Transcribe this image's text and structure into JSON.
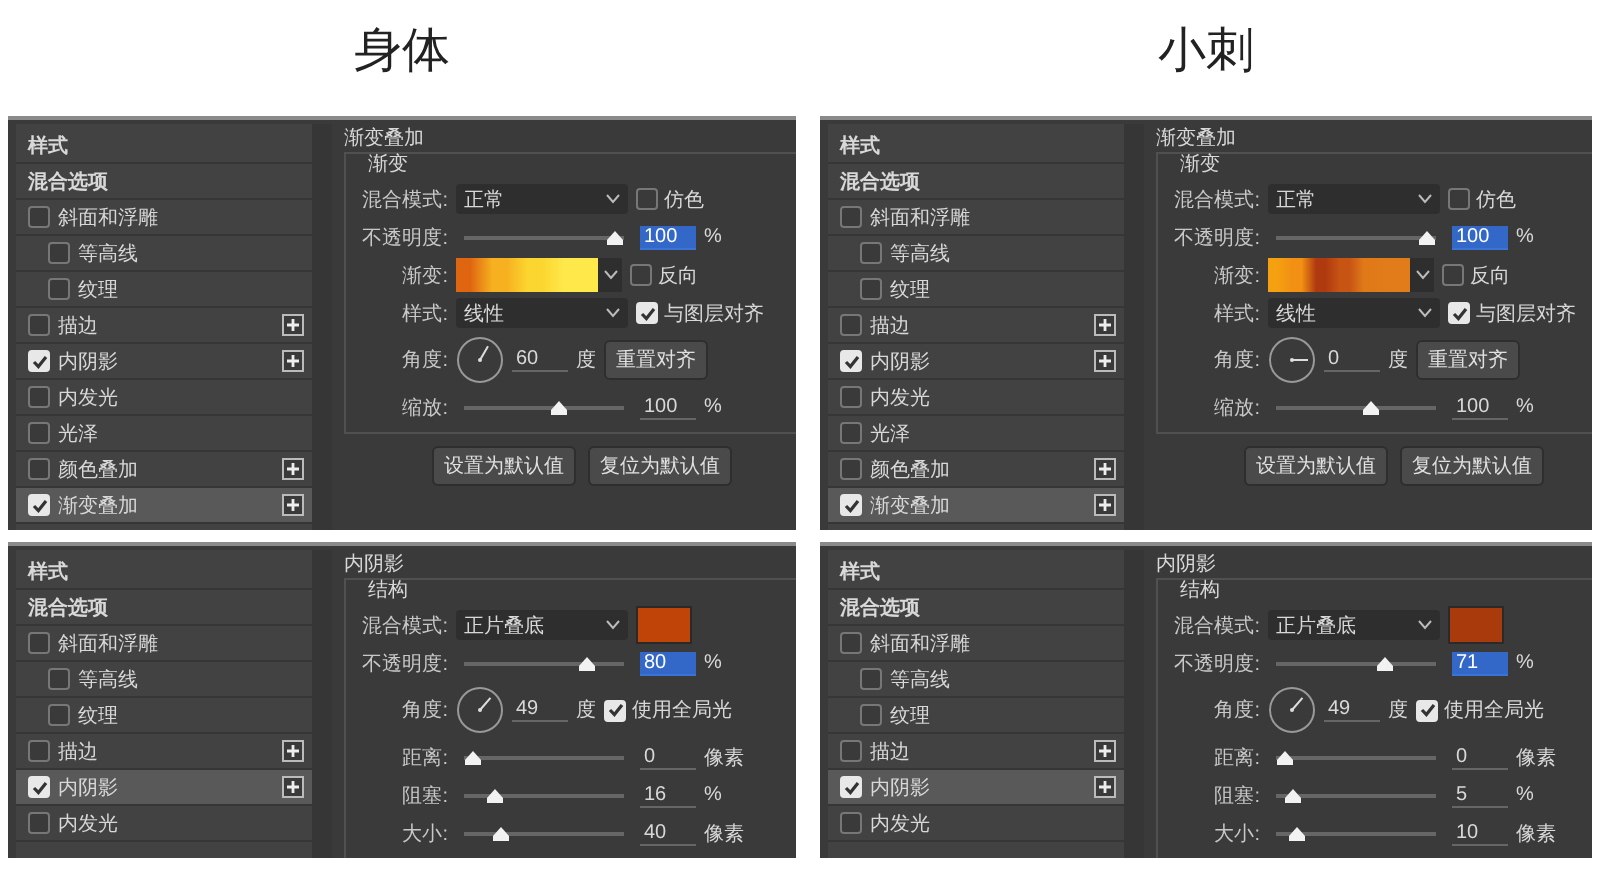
{
  "columns": [
    {
      "heading": "身体",
      "panels": [
        {
          "styles_list": [
            {
              "label": "样式",
              "kind": "header",
              "selected": false
            },
            {
              "label": "混合选项",
              "kind": "header",
              "selected": false
            },
            {
              "label": "斜面和浮雕",
              "kind": "check",
              "checked": false,
              "selected": false,
              "children": [
                {
                  "label": "等高线",
                  "kind": "check",
                  "checked": false,
                  "selected": false
                },
                {
                  "label": "纹理",
                  "kind": "check",
                  "checked": false,
                  "selected": false
                }
              ]
            },
            {
              "label": "描边",
              "kind": "check",
              "checked": false,
              "selected": false,
              "add": true
            },
            {
              "label": "内阴影",
              "kind": "check",
              "checked": true,
              "selected": false,
              "add": true
            },
            {
              "label": "内发光",
              "kind": "check",
              "checked": false,
              "selected": false
            },
            {
              "label": "光泽",
              "kind": "check",
              "checked": false,
              "selected": false
            },
            {
              "label": "颜色叠加",
              "kind": "check",
              "checked": false,
              "selected": false,
              "add": true
            },
            {
              "label": "渐变叠加",
              "kind": "check",
              "checked": true,
              "selected": true,
              "add": true
            }
          ],
          "section_title": "渐变叠加",
          "group_title": "渐变",
          "rows": [
            {
              "kind": "dropdown",
              "label": "混合模式:",
              "value": "正常",
              "checkbox": {
                "label": "仿色",
                "checked": false
              }
            },
            {
              "kind": "slider",
              "label": "不透明度:",
              "level": 1,
              "value": "100",
              "unit": "%",
              "focused": true
            },
            {
              "kind": "gradient",
              "label": "渐变:",
              "gradient_stops": [
                {
                  "color": "#e06510"
                },
                {
                  "color": "#f6b020"
                },
                {
                  "color": "#fcd630"
                },
                {
                  "color": "#ffe84a"
                }
              ],
              "checkbox": {
                "label": "反向",
                "checked": false
              }
            },
            {
              "kind": "dropdown",
              "label": "样式:",
              "value": "线性",
              "checkbox": {
                "label": "与图层对齐",
                "checked": true
              }
            },
            {
              "kind": "angle",
              "label": "角度:",
              "value": "60",
              "unit": "度",
              "button": "重置对齐"
            },
            {
              "kind": "slider",
              "label": "缩放:",
              "level": 0.6,
              "value": "100",
              "unit": "%",
              "focused": false
            }
          ],
          "buttons": [
            "设置为默认值",
            "复位为默认值"
          ]
        },
        {
          "styles_list": [
            {
              "label": "样式",
              "kind": "header",
              "selected": false
            },
            {
              "label": "混合选项",
              "kind": "header",
              "selected": false
            },
            {
              "label": "斜面和浮雕",
              "kind": "check",
              "checked": false,
              "selected": false,
              "children": [
                {
                  "label": "等高线",
                  "kind": "check",
                  "checked": false,
                  "selected": false
                },
                {
                  "label": "纹理",
                  "kind": "check",
                  "checked": false,
                  "selected": false
                }
              ]
            },
            {
              "label": "描边",
              "kind": "check",
              "checked": false,
              "selected": false,
              "add": true
            },
            {
              "label": "内阴影",
              "kind": "check",
              "checked": true,
              "selected": true,
              "add": true
            },
            {
              "label": "内发光",
              "kind": "check",
              "checked": false,
              "selected": false
            }
          ],
          "section_title": "内阴影",
          "group_title": "结构",
          "rows": [
            {
              "kind": "dropdown",
              "label": "混合模式:",
              "value": "正片叠底",
              "color": "#c04408"
            },
            {
              "kind": "slider",
              "label": "不透明度:",
              "level": 0.8,
              "value": "80",
              "unit": "%",
              "focused": true
            },
            {
              "kind": "angle",
              "label": "角度:",
              "value": "49",
              "unit": "度",
              "checkbox": {
                "label": "使用全局光",
                "checked": true
              }
            },
            {
              "kind": "slider",
              "label": "距离:",
              "level": 0,
              "value": "0",
              "unit": "像素",
              "focused": false
            },
            {
              "kind": "slider",
              "label": "阻塞:",
              "level": 0.16,
              "value": "16",
              "unit": "%",
              "focused": false
            },
            {
              "kind": "slider",
              "label": "大小:",
              "level": 0.2,
              "value": "40",
              "unit": "像素",
              "focused": false
            }
          ]
        }
      ]
    },
    {
      "heading": "小刺",
      "panels": [
        {
          "styles_list": [
            {
              "label": "样式",
              "kind": "header",
              "selected": false
            },
            {
              "label": "混合选项",
              "kind": "header",
              "selected": false
            },
            {
              "label": "斜面和浮雕",
              "kind": "check",
              "checked": false,
              "selected": false,
              "children": [
                {
                  "label": "等高线",
                  "kind": "check",
                  "checked": false,
                  "selected": false
                },
                {
                  "label": "纹理",
                  "kind": "check",
                  "checked": false,
                  "selected": false
                }
              ]
            },
            {
              "label": "描边",
              "kind": "check",
              "checked": false,
              "selected": false,
              "add": true
            },
            {
              "label": "内阴影",
              "kind": "check",
              "checked": true,
              "selected": false,
              "add": true
            },
            {
              "label": "内发光",
              "kind": "check",
              "checked": false,
              "selected": false
            },
            {
              "label": "光泽",
              "kind": "check",
              "checked": false,
              "selected": false
            },
            {
              "label": "颜色叠加",
              "kind": "check",
              "checked": false,
              "selected": false,
              "add": true
            },
            {
              "label": "渐变叠加",
              "kind": "check",
              "checked": true,
              "selected": true,
              "add": true
            }
          ],
          "section_title": "渐变叠加",
          "group_title": "渐变",
          "rows": [
            {
              "kind": "dropdown",
              "label": "混合模式:",
              "value": "正常",
              "checkbox": {
                "label": "仿色",
                "checked": false
              }
            },
            {
              "kind": "slider",
              "label": "不透明度:",
              "level": 1,
              "value": "100",
              "unit": "%",
              "focused": true
            },
            {
              "kind": "gradient",
              "label": "渐变:",
              "gradient_stops": [
                {
                  "color": "#f5a010"
                },
                {
                  "color": "#f29014"
                },
                {
                  "color": "#b03a10"
                },
                {
                  "color": "#c85414"
                },
                {
                  "color": "#e07a18"
                },
                {
                  "color": "#e27c1a"
                }
              ],
              "checkbox": {
                "label": "反向",
                "checked": false
              }
            },
            {
              "kind": "dropdown",
              "label": "样式:",
              "value": "线性",
              "checkbox": {
                "label": "与图层对齐",
                "checked": true
              }
            },
            {
              "kind": "angle",
              "label": "角度:",
              "value": "0",
              "unit": "度",
              "button": "重置对齐"
            },
            {
              "kind": "slider",
              "label": "缩放:",
              "level": 0.6,
              "value": "100",
              "unit": "%",
              "focused": false
            }
          ],
          "buttons": [
            "设置为默认值",
            "复位为默认值"
          ]
        },
        {
          "styles_list": [
            {
              "label": "样式",
              "kind": "header",
              "selected": false
            },
            {
              "label": "混合选项",
              "kind": "header",
              "selected": false
            },
            {
              "label": "斜面和浮雕",
              "kind": "check",
              "checked": false,
              "selected": false,
              "children": [
                {
                  "label": "等高线",
                  "kind": "check",
                  "checked": false,
                  "selected": false
                },
                {
                  "label": "纹理",
                  "kind": "check",
                  "checked": false,
                  "selected": false
                }
              ]
            },
            {
              "label": "描边",
              "kind": "check",
              "checked": false,
              "selected": false,
              "add": true
            },
            {
              "label": "内阴影",
              "kind": "check",
              "checked": true,
              "selected": true,
              "add": true
            },
            {
              "label": "内发光",
              "kind": "check",
              "checked": false,
              "selected": false
            }
          ],
          "section_title": "内阴影",
          "group_title": "结构",
          "rows": [
            {
              "kind": "dropdown",
              "label": "混合模式:",
              "value": "正片叠底",
              "color": "#a83a0c"
            },
            {
              "kind": "slider",
              "label": "不透明度:",
              "level": 0.7,
              "value": "71",
              "unit": "%",
              "focused": true
            },
            {
              "kind": "angle",
              "label": "角度:",
              "value": "49",
              "unit": "度",
              "checkbox": {
                "label": "使用全局光",
                "checked": true
              }
            },
            {
              "kind": "slider",
              "label": "距离:",
              "level": 0,
              "value": "0",
              "unit": "像素",
              "focused": false
            },
            {
              "kind": "slider",
              "label": "阻塞:",
              "level": 0.05,
              "value": "5",
              "unit": "%",
              "focused": false
            },
            {
              "kind": "slider",
              "label": "大小:",
              "level": 0.08,
              "value": "10",
              "unit": "像素",
              "focused": false
            }
          ]
        }
      ]
    }
  ]
}
